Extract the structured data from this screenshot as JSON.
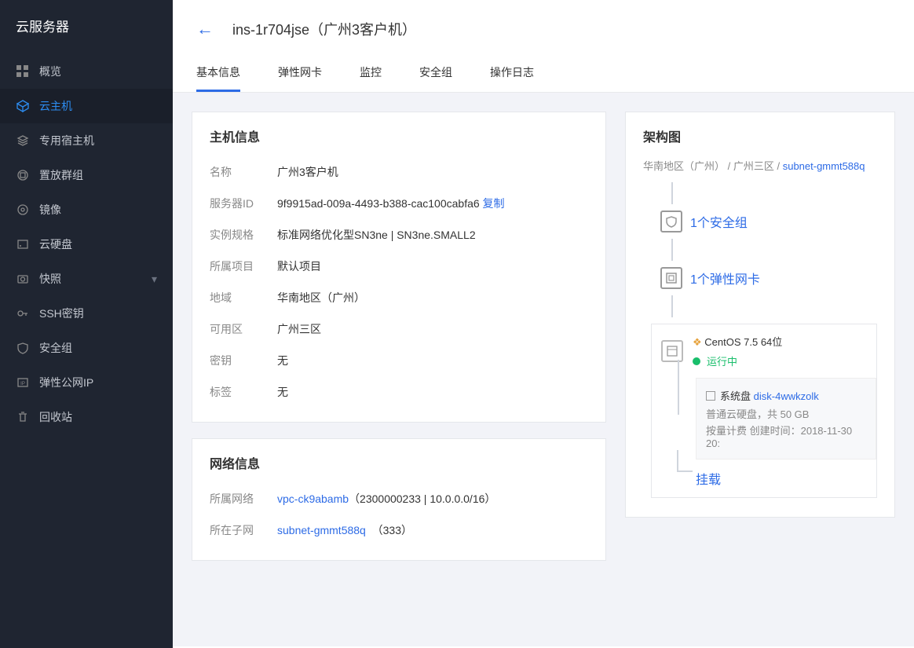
{
  "sidebar": {
    "title": "云服务器",
    "items": [
      {
        "label": "概览",
        "icon": "grid"
      },
      {
        "label": "云主机",
        "icon": "cube",
        "active": true
      },
      {
        "label": "专用宿主机",
        "icon": "layers"
      },
      {
        "label": "置放群组",
        "icon": "group"
      },
      {
        "label": "镜像",
        "icon": "circle"
      },
      {
        "label": "云硬盘",
        "icon": "disk"
      },
      {
        "label": "快照",
        "icon": "camera",
        "expandable": true
      },
      {
        "label": "SSH密钥",
        "icon": "key"
      },
      {
        "label": "安全组",
        "icon": "shield"
      },
      {
        "label": "弹性公网IP",
        "icon": "ip"
      },
      {
        "label": "回收站",
        "icon": "trash"
      }
    ]
  },
  "header": {
    "title": "ins-1r704jse（广州3客户机）"
  },
  "tabs": [
    "基本信息",
    "弹性网卡",
    "监控",
    "安全组",
    "操作日志"
  ],
  "host_info": {
    "title": "主机信息",
    "rows": {
      "name_label": "名称",
      "name_val": "广州3客户机",
      "id_label": "服务器ID",
      "id_val": "9f9915ad-009a-4493-b388-cac100cabfa6",
      "copy": "复制",
      "spec_label": "实例规格",
      "spec_val": "标准网络优化型SN3ne | SN3ne.SMALL2",
      "proj_label": "所属项目",
      "proj_val": "默认项目",
      "region_label": "地域",
      "region_val": "华南地区（广州）",
      "az_label": "可用区",
      "az_val": "广州三区",
      "key_label": "密钥",
      "key_val": "无",
      "tag_label": "标签",
      "tag_val": "无"
    }
  },
  "net_info": {
    "title": "网络信息",
    "vpc_label": "所属网络",
    "vpc_link": "vpc-ck9abamb",
    "vpc_detail": "（2300000233 | 10.0.0.0/16）",
    "subnet_label": "所在子网",
    "subnet_link": "subnet-gmmt588q",
    "subnet_detail": "（333）"
  },
  "arch": {
    "title": "架构图",
    "region": "华南地区（广州）",
    "az": "广州三区",
    "subnet": "subnet-gmmt588q",
    "sg": "1个安全组",
    "nic": "1个弹性网卡",
    "os": "CentOS 7.5 64位",
    "status": "运行中",
    "disk_label": "系统盘",
    "disk_link": "disk-4wwkzolk",
    "disk_line1": "普通云硬盘，共 50 GB",
    "disk_line2": "按量计费 创建时间：2018-11-30 20:",
    "mount": "挂载"
  }
}
